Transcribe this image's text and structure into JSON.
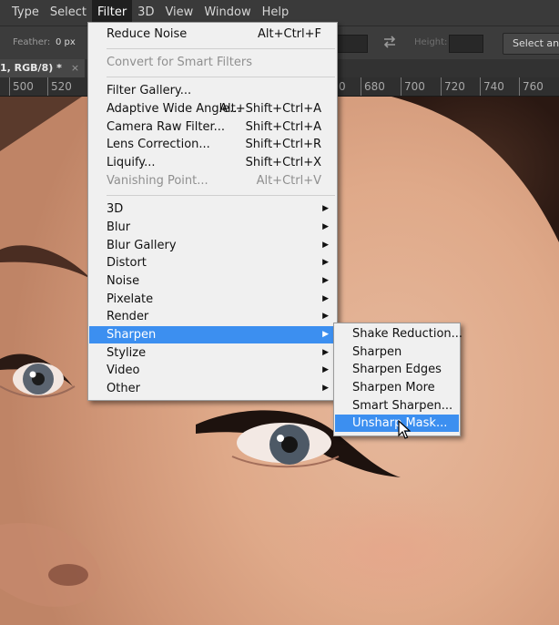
{
  "menubar": {
    "items": [
      "Type",
      "Select",
      "Filter",
      "3D",
      "View",
      "Window",
      "Help"
    ]
  },
  "options_bar": {
    "feather_label": "Feather:",
    "feather_value": "0 px",
    "swap_icon": "swap-arrows-icon",
    "height_label": "Height:",
    "select_button": "Select and"
  },
  "document": {
    "tab_label": "1, RGB/8) *",
    "close": "×"
  },
  "ruler": {
    "labels": [
      "500",
      "520",
      "0",
      "680",
      "700",
      "720",
      "740",
      "760"
    ]
  },
  "filter_menu": {
    "items": [
      {
        "label": "Reduce Noise",
        "shortcut": "Alt+Ctrl+F"
      },
      {
        "label": "Convert for Smart Filters",
        "shortcut": "",
        "disabled": true
      },
      {
        "label": "Filter Gallery...",
        "shortcut": ""
      },
      {
        "label": "Adaptive Wide Angle...",
        "shortcut": "Alt+Shift+Ctrl+A"
      },
      {
        "label": "Camera Raw Filter...",
        "shortcut": "Shift+Ctrl+A"
      },
      {
        "label": "Lens Correction...",
        "shortcut": "Shift+Ctrl+R"
      },
      {
        "label": "Liquify...",
        "shortcut": "Shift+Ctrl+X"
      },
      {
        "label": "Vanishing Point...",
        "shortcut": "Alt+Ctrl+V",
        "disabled": true
      },
      {
        "label": "3D",
        "submenu": true
      },
      {
        "label": "Blur",
        "submenu": true
      },
      {
        "label": "Blur Gallery",
        "submenu": true
      },
      {
        "label": "Distort",
        "submenu": true
      },
      {
        "label": "Noise",
        "submenu": true
      },
      {
        "label": "Pixelate",
        "submenu": true
      },
      {
        "label": "Render",
        "submenu": true
      },
      {
        "label": "Sharpen",
        "submenu": true,
        "highlighted": true
      },
      {
        "label": "Stylize",
        "submenu": true
      },
      {
        "label": "Video",
        "submenu": true
      },
      {
        "label": "Other",
        "submenu": true
      }
    ],
    "arrow_glyph": "▶"
  },
  "sharpen_menu": {
    "items": [
      {
        "label": "Shake Reduction..."
      },
      {
        "label": "Sharpen"
      },
      {
        "label": "Sharpen Edges"
      },
      {
        "label": "Sharpen More"
      },
      {
        "label": "Smart Sharpen..."
      },
      {
        "label": "Unsharp Mask...",
        "highlighted": true
      }
    ]
  },
  "colors": {
    "menu_highlight": "#3c8ff0",
    "menu_bg": "#f0f0f0",
    "active_menubar": "#1f1f1f"
  }
}
